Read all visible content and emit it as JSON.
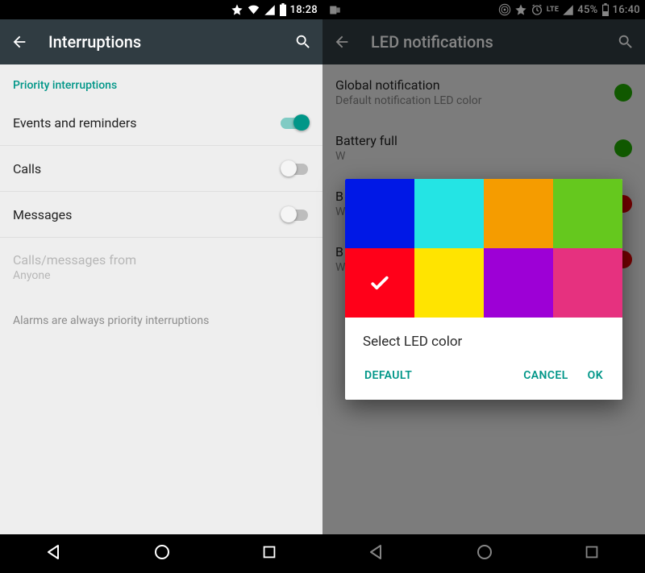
{
  "left": {
    "statusbar": {
      "time": "18:28"
    },
    "appbar": {
      "title": "Interruptions"
    },
    "section_header": "Priority interruptions",
    "rows": {
      "events": {
        "label": "Events and reminders",
        "on": true
      },
      "calls": {
        "label": "Calls",
        "on": false
      },
      "messages": {
        "label": "Messages",
        "on": false
      },
      "from": {
        "label": "Calls/messages from",
        "sublabel": "Anyone"
      }
    },
    "note": "Alarms are always priority interruptions"
  },
  "right": {
    "statusbar": {
      "battery_pct": "45%",
      "time": "16:40",
      "signal_label": "LTE"
    },
    "appbar": {
      "title": "LED notifications"
    },
    "rows": [
      {
        "title": "Global notification",
        "sub": "Default notification LED color",
        "dot": "#1faa00"
      },
      {
        "title": "Battery full",
        "sub": "W",
        "dot": "#1faa00"
      },
      {
        "title": "B",
        "sub": "W",
        "dot": "#e30000"
      },
      {
        "title": "B",
        "sub": "W",
        "dot": "#e30000"
      }
    ],
    "dialog": {
      "title": "Select LED color",
      "colors": [
        "#0018e6",
        "#24e4e4",
        "#f59c00",
        "#65c81e",
        "#ff0019",
        "#ffe400",
        "#9d00d6",
        "#e6317f"
      ],
      "selected_index": 4,
      "buttons": {
        "default": "DEFAULT",
        "cancel": "CANCEL",
        "ok": "OK"
      }
    }
  }
}
